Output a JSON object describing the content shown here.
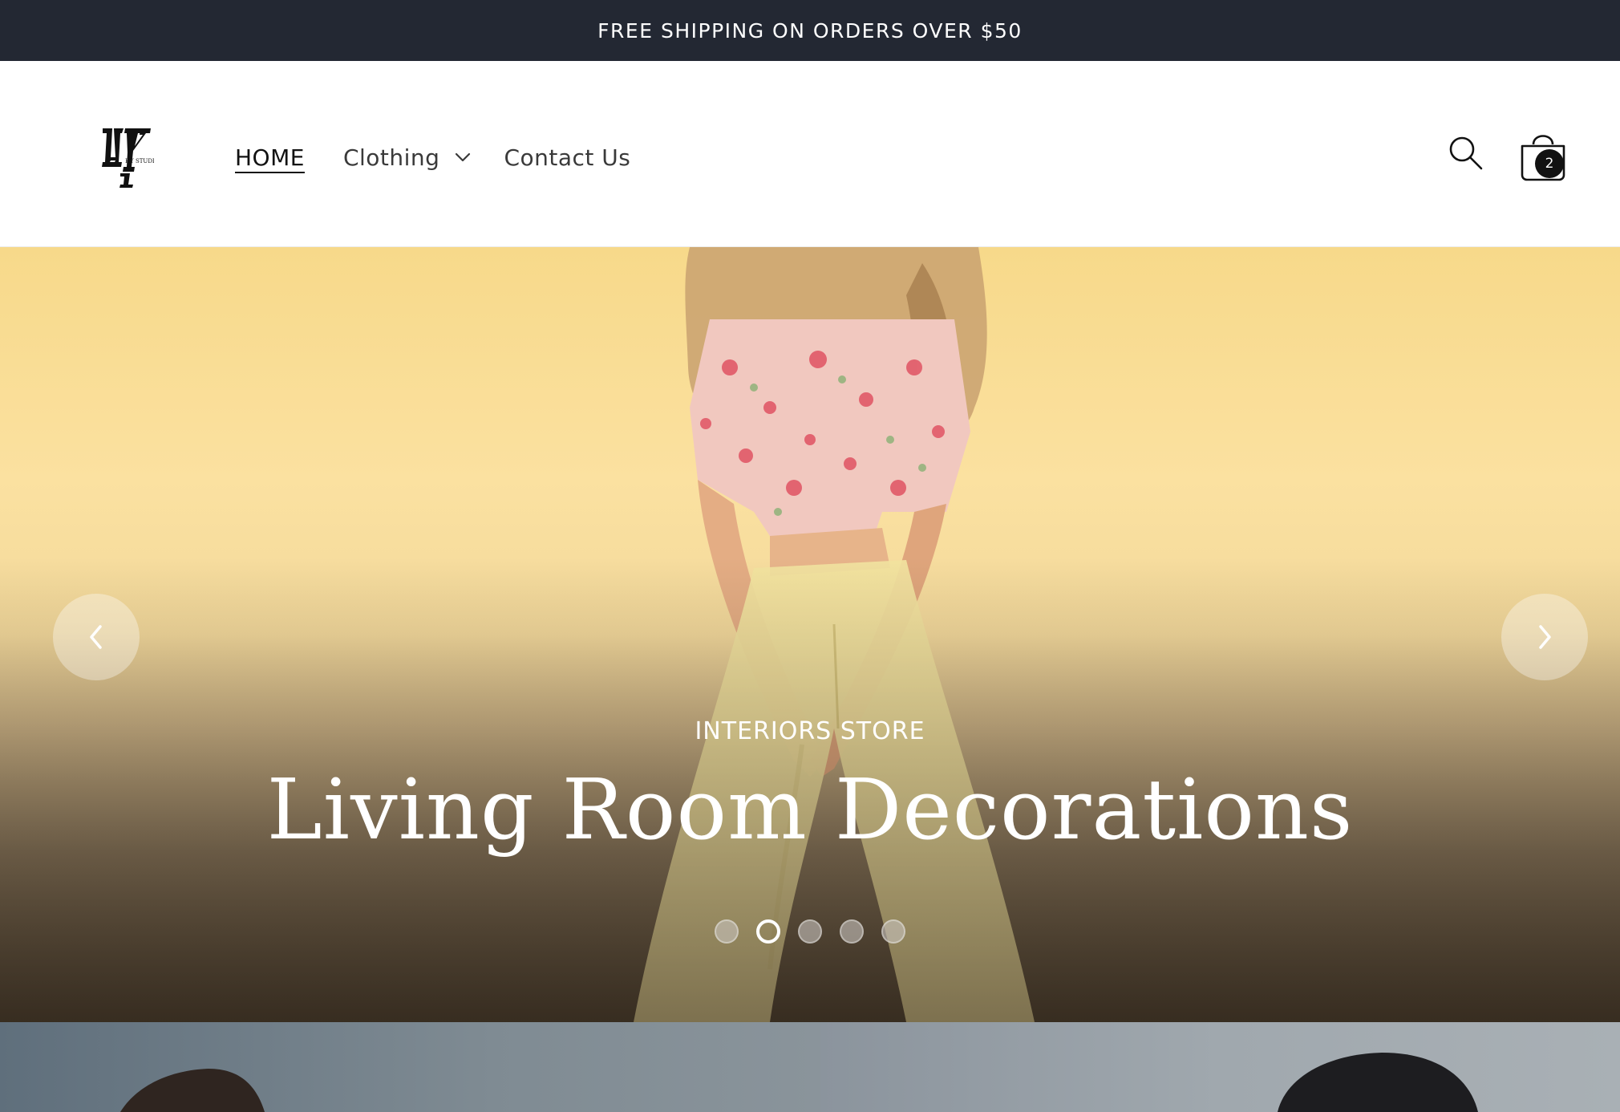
{
  "announcement": {
    "text": "FREE SHIPPING ON ORDERS OVER $50"
  },
  "header": {
    "logo_icon": "hy-studio-logo",
    "nav": [
      {
        "label": "HOME",
        "active": true
      },
      {
        "label": "Clothing",
        "has_dropdown": true
      },
      {
        "label": "Contact Us"
      }
    ],
    "search_icon": "search-icon",
    "cart_icon": "shopping-bag-icon",
    "cart_count": "2"
  },
  "hero": {
    "kicker": "INTERIORS STORE",
    "title": "Living Room Decorations",
    "slide_count": 5,
    "active_slide": 2,
    "prev_icon": "chevron-left-icon",
    "next_icon": "chevron-right-icon"
  },
  "colors": {
    "announcement_bg": "#232833",
    "text_dark": "#121212",
    "hero_warm": "#f7d98a"
  }
}
